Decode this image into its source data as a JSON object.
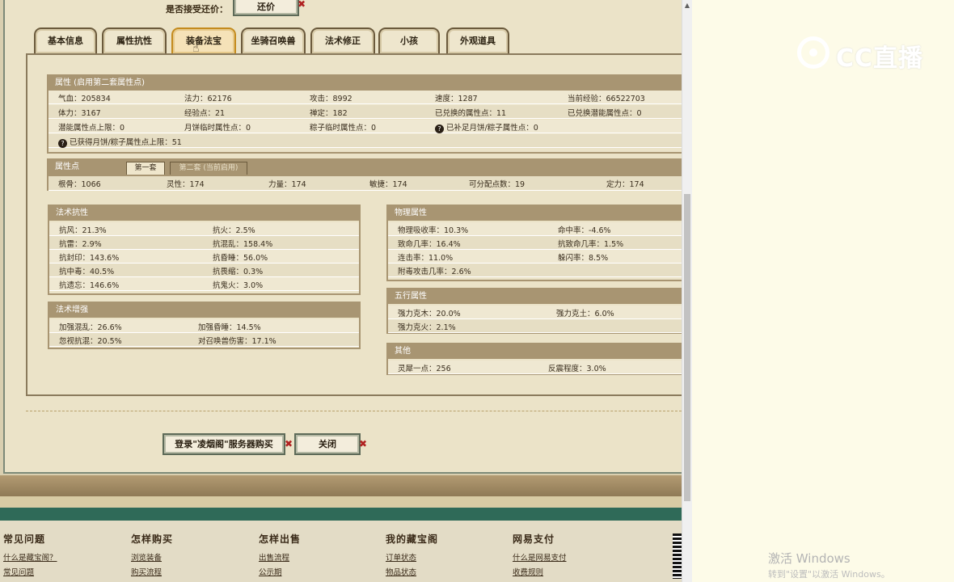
{
  "offer": {
    "label": "是否接受还价：",
    "button": "还价"
  },
  "tabs": [
    "基本信息",
    "属性抗性",
    "装备法宝",
    "坐骑召唤兽",
    "法术修正",
    "小孩",
    "外观道具"
  ],
  "active_tab": "装备法宝",
  "attributes": {
    "header": "属性 (启用第二套属性点)",
    "rows": [
      [
        "气血：205834",
        "法力：62176",
        "攻击：8992",
        "速度：1287",
        "当前经验：66522703"
      ],
      [
        "体力：3167",
        "经验点：21",
        "禅定：182",
        "已兑换的属性点：11",
        "已兑换潜能属性点：0"
      ],
      [
        "潜能属性点上限：0",
        "月饼临时属性点：0",
        "粽子临时属性点：0",
        "已补足月饼/粽子属性点：0",
        ""
      ],
      [
        "已获得月饼/粽子属性点上限：51"
      ]
    ]
  },
  "points": {
    "header": "属性点",
    "subtabs": [
      "第一套",
      "第二套 (当前启用)"
    ],
    "row": [
      "根骨：1066",
      "灵性：174",
      "力量：174",
      "敏捷：174",
      "可分配点数：19",
      "定力：174"
    ]
  },
  "magic_resist": {
    "header": "法术抗性",
    "rows": [
      [
        "抗风：21.3%",
        "抗火：2.5%"
      ],
      [
        "抗雷：2.9%",
        "抗混乱：158.4%"
      ],
      [
        "抗封印：143.6%",
        "抗昏睡：56.0%"
      ],
      [
        "抗中毒：40.5%",
        "抗畏缩：0.3%"
      ],
      [
        "抗遗忘：146.6%",
        "抗鬼火：3.0%"
      ]
    ]
  },
  "magic_boost": {
    "header": "法术增强",
    "rows": [
      [
        "加强混乱：26.6%",
        "加强昏睡：14.5%"
      ],
      [
        "忽视抗混：20.5%",
        "对召唤兽伤害：17.1%"
      ]
    ]
  },
  "physical": {
    "header": "物理属性",
    "rows": [
      [
        "物理吸收率：10.3%",
        "命中率：-4.6%"
      ],
      [
        "致命几率：16.4%",
        "抗致命几率：1.5%"
      ],
      [
        "连击率：11.0%",
        "躲闪率：8.5%"
      ],
      [
        "附毒攻击几率：2.6%",
        ""
      ]
    ]
  },
  "five_elements": {
    "header": "五行属性",
    "rows": [
      [
        "强力克木：20.0%",
        "强力克土：6.0%"
      ],
      [
        "强力克火：2.1%",
        ""
      ]
    ]
  },
  "others": {
    "header": "其他",
    "rows": [
      [
        "灵犀一点：256",
        "反震程度：3.0%"
      ]
    ]
  },
  "buttons": {
    "buy": "登录\"凌烟阁\"服务器购买",
    "close": "关闭"
  },
  "footer": {
    "cols": [
      {
        "title": "常见问题",
        "links": [
          "什么是藏宝阁？",
          "常见问题"
        ]
      },
      {
        "title": "怎样购买",
        "links": [
          "浏览装备",
          "购买流程"
        ]
      },
      {
        "title": "怎样出售",
        "links": [
          "出售流程",
          "公示期"
        ]
      },
      {
        "title": "我的藏宝阁",
        "links": [
          "订单状态",
          "物品状态"
        ]
      },
      {
        "title": "网易支付",
        "links": [
          "什么是网易支付",
          "收费规则"
        ]
      }
    ]
  },
  "overlay": {
    "logo": "CC直播",
    "watermark1": "激活 Windows",
    "watermark2": "转到\"设置\"以激活 Windows。"
  }
}
